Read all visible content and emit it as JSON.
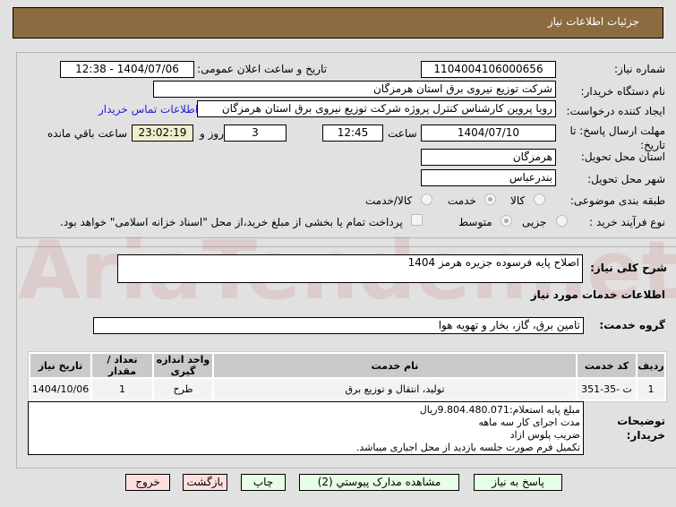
{
  "header": {
    "title": "جزئیات اطلاعات نیاز"
  },
  "form": {
    "need_number_label": "شماره نیاز:",
    "need_number": "1104004106000656",
    "announce_label": "تاریخ و ساعت اعلان عمومی:",
    "announce_value": "1404/07/06 - 12:38",
    "buyer_org_label": "نام دستگاه خریدار:",
    "buyer_org": "شرکت توزیع نیروی برق استان هرمزگان",
    "creator_label": "ایجاد کننده درخواست:",
    "creator": "رویا پروین کارشناس کنترل پروژه شرکت توزیع نیروی برق استان هرمزگان",
    "contact_link": "اطلاعات تماس خریدار",
    "deadline_label": "مهلت ارسال پاسخ: تا تاریخ:",
    "deadline_date": "1404/07/10",
    "time_label": "ساعت",
    "deadline_time": "12:45",
    "days": "3",
    "days_label": "روز و",
    "remaining": "23:02:19",
    "remaining_label": "ساعت باقي مانده",
    "province_label": "استان محل تحویل:",
    "province": "هرمزگان",
    "city_label": "شهر محل تحویل:",
    "city": "بندرعباس",
    "category_label": "طبقه بندی موضوعی:",
    "category_options": [
      "کالا",
      "خدمت",
      "کالا/خدمت"
    ],
    "category_selected": "خدمت",
    "process_label": "نوع فرآیند خرید :",
    "process_options": [
      "جزیی",
      "متوسط"
    ],
    "process_selected": "متوسط",
    "payment_note": "پرداخت تمام یا بخشی از مبلغ خرید،از محل \"اسناد خزانه اسلامی\" خواهد بود."
  },
  "details": {
    "summary_label": "شرح کلی نیاز:",
    "summary": "اصلاح پایه فرسوده جزیره هرمز 1404",
    "services_title": "اطلاعات خدمات مورد نیاز",
    "group_label": "گروه خدمت:",
    "group": "تامین برق، گاز، بخار و تهویه هوا",
    "table": {
      "headers": [
        "ردیف",
        "کد خدمت",
        "نام خدمت",
        "واحد اندازه گیری",
        "تعداد / مقدار",
        "تاریخ نیاز"
      ],
      "rows": [
        [
          "1",
          "ت -35-351",
          "تولید، انتقال و توزیع برق",
          "طرح",
          "1",
          "1404/10/06"
        ]
      ]
    },
    "buyer_notes_label": "توضیحات خریدار:",
    "buyer_notes": [
      "مبلغ پایه استعلام:9.804.480.071ریال",
      "مدت اجرای کار سه ماهه",
      "ضریب پلوس ازاد",
      "تکمیل فرم صورت جلسه بازدید از محل اجباری میباشد."
    ]
  },
  "buttons": {
    "reply": "پاسخ به نیاز",
    "attachments": "مشاهده مدارک پیوستي (2)",
    "print": "چاپ",
    "back": "بازگشت",
    "exit": "خروج"
  },
  "watermark": "AriaTender.net"
}
